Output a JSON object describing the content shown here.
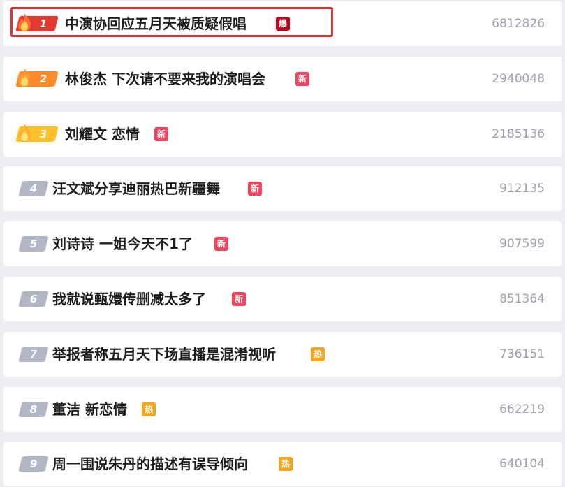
{
  "colors": {
    "rank1": "#e23a2f",
    "rank2": "#ff8a2a",
    "rank3": "#ffc02a",
    "rank_other": "#b1b7c4",
    "tag_bao": "#c3001c",
    "tag_xin": "#f0455e",
    "tag_re": "#f3a51b",
    "highlight_border": "#e23134"
  },
  "items": [
    {
      "rank": "1",
      "title": "中演协回应五月天被质疑假唱",
      "tag": "爆",
      "count": "6812826",
      "icon": "flame-icon"
    },
    {
      "rank": "2",
      "title": "林俊杰 下次请不要来我的演唱会",
      "tag": "新",
      "count": "2940048",
      "icon": "flame-icon"
    },
    {
      "rank": "3",
      "title": "刘耀文 恋情",
      "tag": "新",
      "count": "2185136",
      "icon": "flame-icon"
    },
    {
      "rank": "4",
      "title": "汪文斌分享迪丽热巴新疆舞",
      "tag": "新",
      "count": "912135"
    },
    {
      "rank": "5",
      "title": "刘诗诗 一姐今天不1了",
      "tag": "新",
      "count": "907599"
    },
    {
      "rank": "6",
      "title": "我就说甄嬛传删减太多了",
      "tag": "新",
      "count": "851364"
    },
    {
      "rank": "7",
      "title": "举报者称五月天下场直播是混淆视听",
      "tag": "热",
      "count": "736151"
    },
    {
      "rank": "8",
      "title": "董洁 新恋情",
      "tag": "热",
      "count": "662219"
    },
    {
      "rank": "9",
      "title": "周一围说朱丹的描述有误导倾向",
      "tag": "热",
      "count": "640104"
    }
  ]
}
